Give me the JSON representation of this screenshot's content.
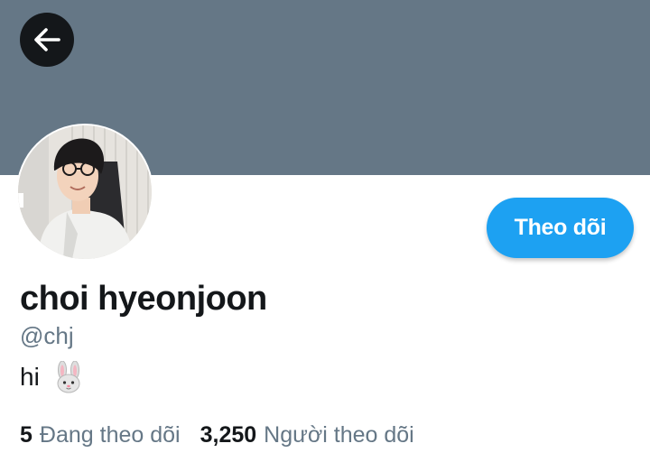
{
  "profile": {
    "name": "choi hyeonjoon",
    "handle": "@chj",
    "bio_text": "hi",
    "bio_emoji": "rabbit-face-icon",
    "follow_label": "Theo dõi"
  },
  "stats": {
    "following_count": "5",
    "following_label": "Đang theo dõi",
    "followers_count": "3,250",
    "followers_label": "Người theo dõi"
  },
  "colors": {
    "banner": "#657786",
    "accent": "#1da1f2",
    "text_primary": "#14171a",
    "text_secondary": "#657786"
  },
  "icons": {
    "back": "arrow-left-icon"
  }
}
